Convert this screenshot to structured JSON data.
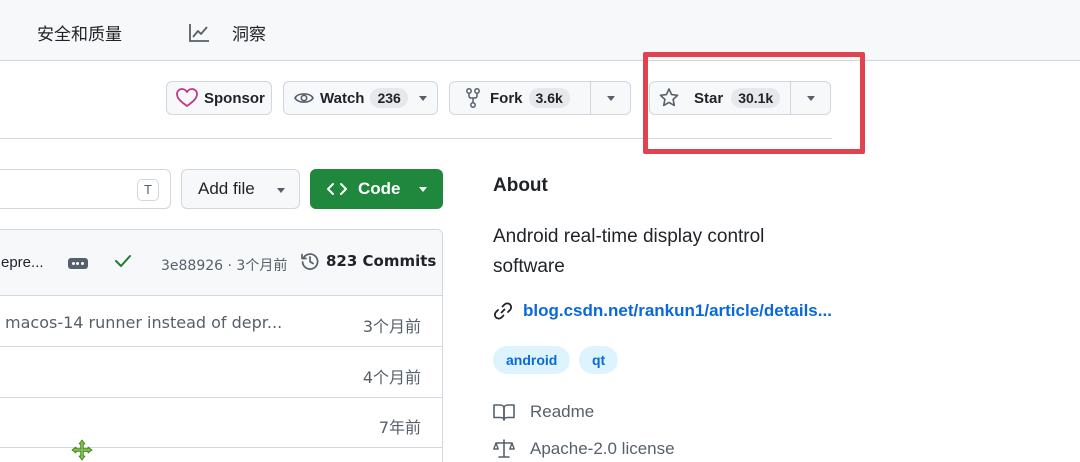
{
  "nav": {
    "security": "安全和质量",
    "insights": "洞察"
  },
  "actions": {
    "sponsor": "Sponsor",
    "watch": {
      "label": "Watch",
      "count": "236"
    },
    "fork": {
      "label": "Fork",
      "count": "3.6k"
    },
    "star": {
      "label": "Star",
      "count": "30.1k"
    }
  },
  "files": {
    "goto_shortcut": "T",
    "add_file": "Add file",
    "code": "Code",
    "latest_commit": {
      "message": "epre...",
      "sha_time": "3e88926 · 3个月前",
      "commits": "823 Commits"
    },
    "rows": [
      {
        "message": "macos-14 runner instead of depr...",
        "age": "3个月前"
      },
      {
        "message": "",
        "age": "4个月前"
      },
      {
        "message": "",
        "age": "7年前"
      }
    ]
  },
  "about": {
    "title": "About",
    "description": "Android real-time display control software",
    "link": "blog.csdn.net/rankun1/article/details...",
    "topics": [
      "android",
      "qt"
    ],
    "readme": "Readme",
    "license": "Apache-2.0 license"
  },
  "colors": {
    "primary_green": "#1f883d",
    "link_blue": "#0969da",
    "highlight_red": "#e0424f",
    "sponsor_pink": "#bf3989"
  }
}
